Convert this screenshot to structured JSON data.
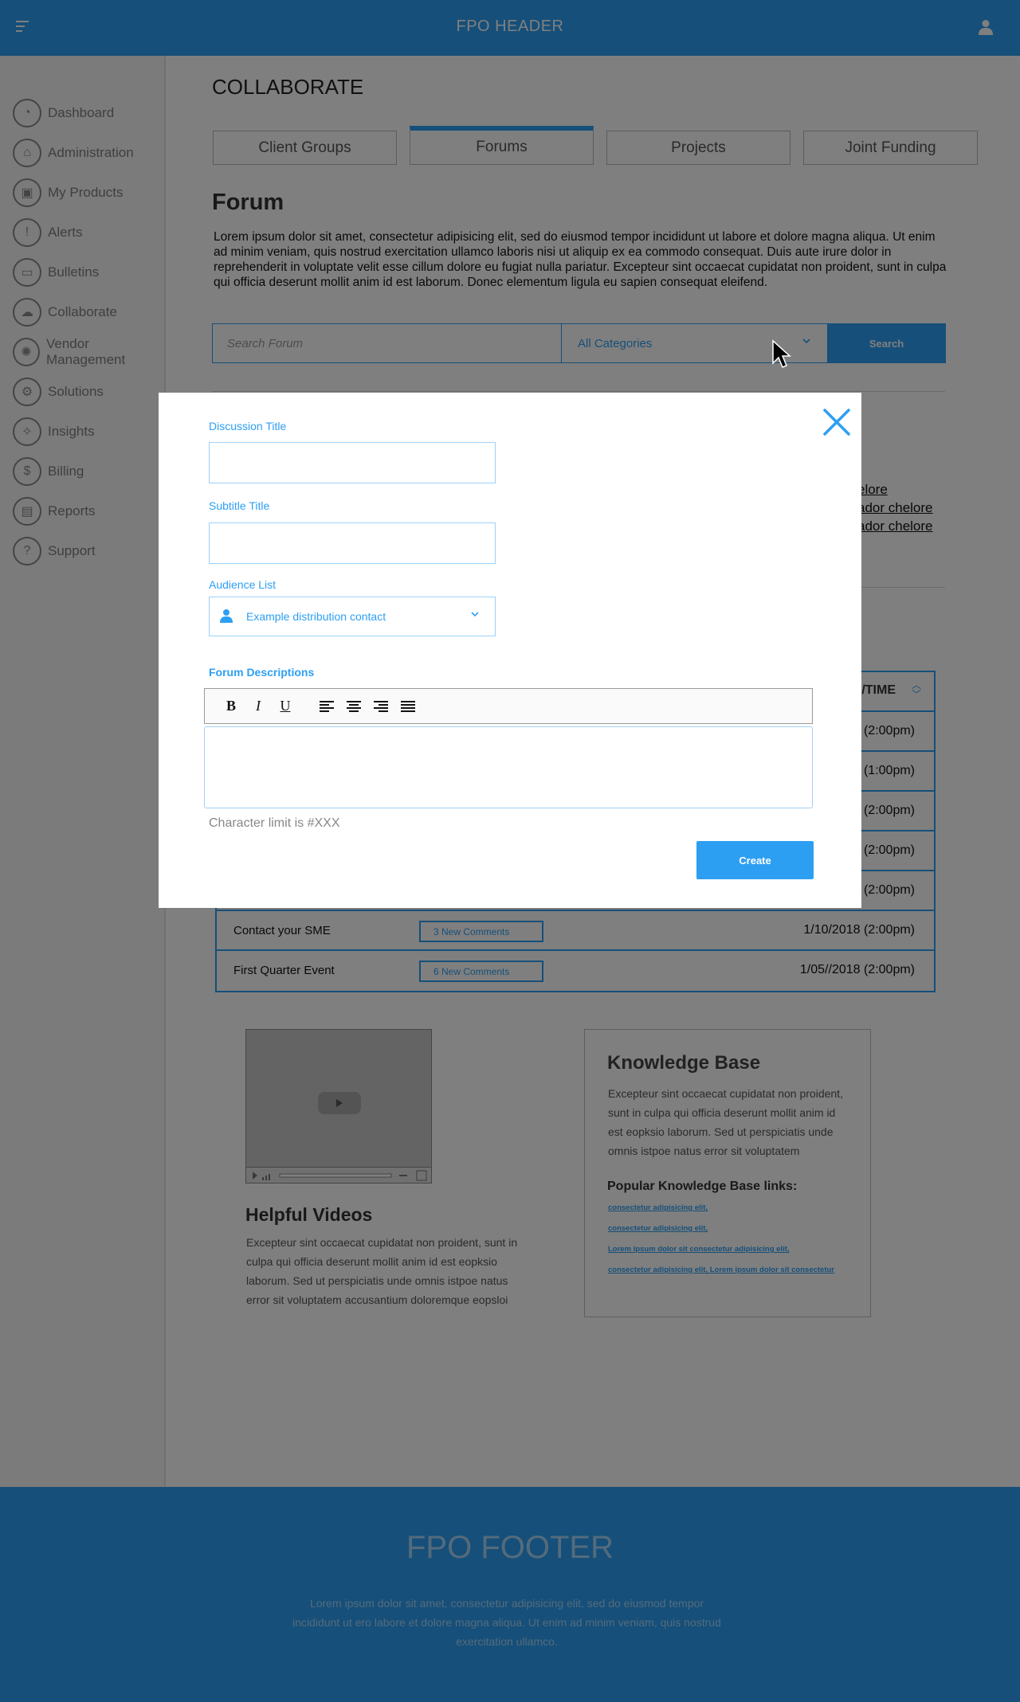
{
  "header": {
    "title": "FPO HEADER"
  },
  "sidebar": {
    "items": [
      {
        "label": "Dashboard",
        "icon": "dashboard-icon"
      },
      {
        "label": "Administration",
        "icon": "bank-icon"
      },
      {
        "label": "My Products",
        "icon": "box-icon"
      },
      {
        "label": "Alerts",
        "icon": "alert-icon"
      },
      {
        "label": "Bulletins",
        "icon": "folder-icon"
      },
      {
        "label": "Collaborate",
        "icon": "chat-icon"
      },
      {
        "label": "Vendor Management",
        "icon": "vendor-icon"
      },
      {
        "label": "Solutions",
        "icon": "gears-icon"
      },
      {
        "label": "Insights",
        "icon": "lightbulb-icon"
      },
      {
        "label": "Billing",
        "icon": "billing-icon"
      },
      {
        "label": "Reports",
        "icon": "reports-icon"
      },
      {
        "label": "Support",
        "icon": "question-icon"
      }
    ]
  },
  "main": {
    "heading": "COLLABORATE",
    "tabs": [
      {
        "label": "Client Groups",
        "active": false
      },
      {
        "label": "Forums",
        "active": true
      },
      {
        "label": "Projects",
        "active": false
      },
      {
        "label": "Joint Funding",
        "active": false
      }
    ],
    "forum_title": "Forum",
    "forum_description": "Lorem ipsum dolor sit amet, consectetur adipisicing elit, sed do eiusmod tempor incididunt ut labore et dolore magna aliqua. Ut enim ad minim veniam, quis nostrud exercitation ullamco laboris nisi ut aliquip ex ea commodo consequat. Duis aute irure dolor in reprehenderit in voluptate velit esse cillum dolore eu fugiat nulla pariatur. Excepteur sint occaecat cupidatat non proident, sunt in culpa qui officia deserunt mollit anim id est laborum. Donec elementum ligula eu sapien consequat eleifend.",
    "search": {
      "placeholder": "Search Forum",
      "category": "All Categories",
      "button": "Search"
    },
    "behind_links": [
      "elore",
      "ador chelore",
      "ador chelore"
    ]
  },
  "table": {
    "header_date": "/TIME",
    "partial_dates": [
      "(2:00pm)",
      "(1:00pm)",
      "(2:00pm)",
      "(2:00pm)",
      "(2:00pm)"
    ],
    "rows": [
      {
        "topic": "Contact your SME",
        "comments": "3 New Comments",
        "date": "1/10/2018 (2:00pm)"
      },
      {
        "topic": "First Quarter Event",
        "comments": "6 New Comments",
        "date": "1/05//2018 (2:00pm)"
      }
    ]
  },
  "videos": {
    "title": "Helpful Videos",
    "description": "Excepteur sint occaecat cupidatat non proident, sunt in culpa qui officia deserunt mollit anim id est eopksio laborum. Sed ut perspiciatis unde omnis istpoe natus error sit voluptatem accusantium doloremque eopsloi"
  },
  "knowledge_base": {
    "title": "Knowledge Base",
    "description": "Excepteur sint occaecat cupidatat non proident, sunt in culpa qui officia deserunt mollit anim id est eopksio laborum. Sed ut perspiciatis unde omnis istpoe natus error sit voluptatem",
    "links_title": "Popular Knowledge Base links:",
    "links": [
      "consectetur adipisicing elit,",
      "consectetur adipisicing elit,",
      "Lorem ipsum dolor sit consectetur adipisicing elit,",
      "consectetur adipisicing elit, Lorem ipsum dolor sit consectetur"
    ]
  },
  "footer": {
    "title": "FPO FOOTER",
    "text": "Lorem ipsum dolor sit amet, consectetur adipisicing elit, sed do eiusmod tempor incididunt ut ero labore et dolore magna aliqua. Ut enim ad minim veniam, quis nostrud exercitation ullamco."
  },
  "modal": {
    "discussion_title_label": "Discussion Title",
    "discussion_title_value": "",
    "subtitle_label": "Subtitle Title",
    "subtitle_value": "",
    "audience_label": "Audience List",
    "audience_value": "Example distribution contact",
    "descriptions_label": "Forum Descriptions",
    "toolbar": {
      "bold": "B",
      "italic": "I",
      "underline": "U"
    },
    "char_limit": "Character limit is #XXX",
    "create_button": "Create"
  },
  "colors": {
    "accent": "#2d9ff3",
    "overlay": "rgba(0,0,0,0.5)"
  }
}
